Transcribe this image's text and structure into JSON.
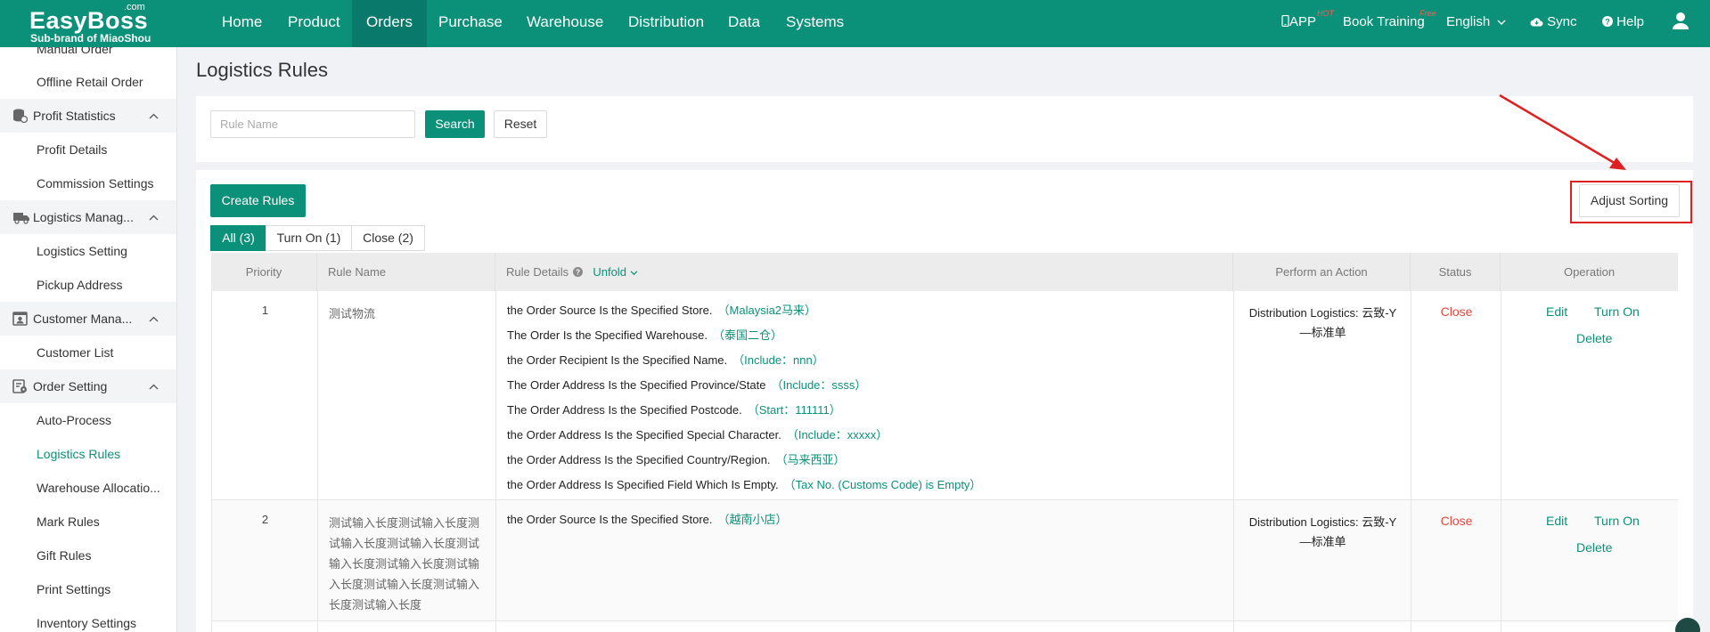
{
  "header": {
    "logo_com": ".com",
    "logo_brand": "EasyBoss",
    "logo_sub": "Sub-brand of MiaoShou",
    "nav": [
      "Home",
      "Product",
      "Orders",
      "Purchase",
      "Warehouse",
      "Distribution",
      "Data",
      "Systems"
    ],
    "active_nav": "Orders",
    "app_label": "APP",
    "app_badge": "HOT",
    "training_label": "Book Training",
    "training_badge": "Free",
    "language": "English",
    "sync_label": "Sync",
    "help_label": "Help"
  },
  "sidebar": {
    "items_top": [
      "Manual Order",
      "Offline Retail Order"
    ],
    "groups": [
      {
        "label": "Profit Statistics",
        "icon": "chart-db-icon",
        "items": [
          "Profit Details",
          "Commission Settings"
        ]
      },
      {
        "label": "Logistics Manag...",
        "icon": "truck-icon",
        "items": [
          "Logistics Setting",
          "Pickup Address"
        ]
      },
      {
        "label": "Customer Mana...",
        "icon": "customer-card-icon",
        "items": [
          "Customer List"
        ]
      },
      {
        "label": "Order Setting",
        "icon": "order-gear-icon",
        "items": [
          "Auto-Process",
          "Logistics Rules",
          "Warehouse Allocatio...",
          "Mark Rules",
          "Gift Rules",
          "Print Settings",
          "Inventory Settings"
        ]
      }
    ],
    "active_item": "Logistics Rules"
  },
  "page": {
    "title": "Logistics Rules",
    "search_placeholder": "Rule Name",
    "search_label": "Search",
    "reset_label": "Reset",
    "create_label": "Create Rules",
    "adjust_sorting_label": "Adjust Sorting",
    "tabs": [
      "All (3)",
      "Turn On (1)",
      "Close (2)"
    ],
    "active_tab": "All (3)"
  },
  "table": {
    "columns": {
      "priority": "Priority",
      "rule_name": "Rule Name",
      "rule_details": "Rule Details",
      "unfold": "Unfold",
      "action": "Perform an Action",
      "status": "Status",
      "operation": "Operation"
    },
    "rows": [
      {
        "priority": "1",
        "rule_name": "测试物流",
        "conditions": [
          {
            "label": "the Order Source Is the Specified Store.",
            "value": "（Malaysia2马来）"
          },
          {
            "label": "The Order Is the Specified Warehouse.",
            "value": "（泰国二仓）"
          },
          {
            "label": "the Order Recipient Is the Specified Name.",
            "value": "（Include：nnn）"
          },
          {
            "label": "The Order Address Is the Specified Province/State",
            "value": "（Include：ssss）"
          },
          {
            "label": "The Order Address Is the Specified Postcode.",
            "value": "（Start：111111）"
          },
          {
            "label": "the Order Address Is the Specified Special Character.",
            "value": "（Include：xxxxx）"
          },
          {
            "label": "the Order Address Is the Specified Country/Region.",
            "value": "（马来西亚）"
          },
          {
            "label": "the Order Address Is Specified Field Which Is Empty.",
            "value": "（Tax No. (Customs Code) is Empty）"
          }
        ],
        "action_line1": "Distribution Logistics: 云致-Y",
        "action_line2": "—标准单",
        "status": "Close",
        "op_edit": "Edit",
        "op_toggle": "Turn On",
        "op_delete": "Delete"
      },
      {
        "priority": "2",
        "rule_name": "测试输入长度测试输入长度测试输入长度测试输入长度测试输入长度测试输入长度测试输入长度测试输入长度测试输入长度测试输入长度",
        "conditions": [
          {
            "label": "the Order Source Is the Specified Store.",
            "value": "（越南小店）"
          }
        ],
        "action_line1": "Distribution Logistics: 云致-Y",
        "action_line2": "—标准单",
        "status": "Close",
        "op_edit": "Edit",
        "op_toggle": "Turn On",
        "op_delete": "Delete"
      }
    ]
  },
  "colors": {
    "brand": "#0b907a",
    "danger": "#e6473a",
    "annotation": "#e02020"
  }
}
